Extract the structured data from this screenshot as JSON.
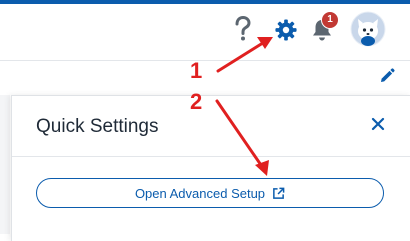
{
  "header": {
    "help_icon": "question-mark-icon",
    "settings_icon": "gear-icon",
    "notifications": {
      "icon": "bell-icon",
      "count": "1"
    },
    "avatar": "user-avatar"
  },
  "toolbar": {
    "edit_icon": "pencil-icon"
  },
  "quick_settings": {
    "title": "Quick Settings",
    "close_icon": "close-icon",
    "open_setup_label": "Open Advanced Setup",
    "open_setup_icon": "external-link-icon"
  },
  "annotations": {
    "step1": "1",
    "step2": "2",
    "color": "#e02020"
  },
  "colors": {
    "brand": "#0b5cad",
    "badge": "#c23934",
    "accent_top": "#0b5cad"
  }
}
